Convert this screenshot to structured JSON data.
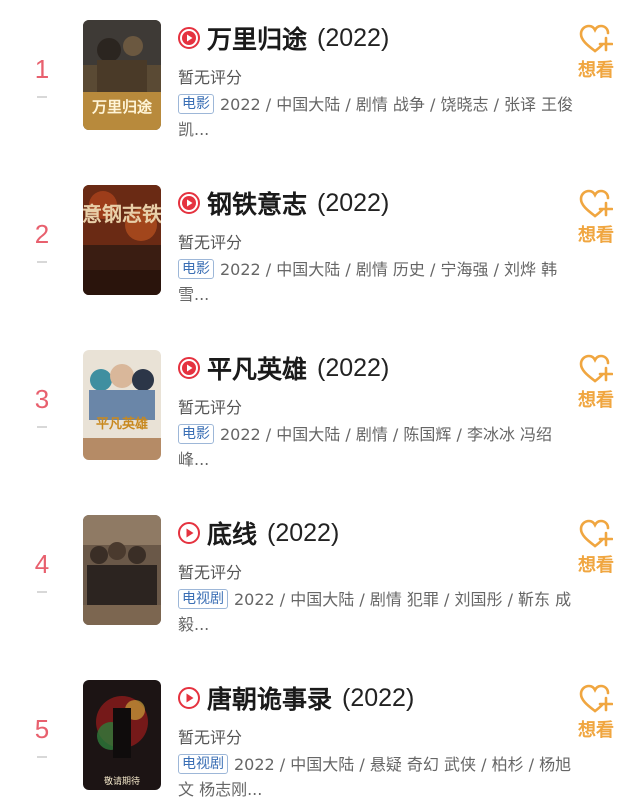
{
  "colors": {
    "rank": "#e8606e",
    "accent_orange": "#f0a640",
    "badge_blue": "#3b6fb5",
    "play_red": "#e5323f"
  },
  "items": [
    {
      "rank": "1",
      "play_icon": "movie-play-icon",
      "title": "万里归途",
      "year": "(2022)",
      "rating": "暂无评分",
      "badge": "电影",
      "meta": "2022 / 中国大陆 / 剧情 战争 / 饶晓志 / 张译 王俊凯...",
      "want_label": "想看",
      "poster_text": "万里归途"
    },
    {
      "rank": "2",
      "play_icon": "movie-play-icon",
      "title": "钢铁意志",
      "year": "(2022)",
      "rating": "暂无评分",
      "badge": "电影",
      "meta": "2022 / 中国大陆 / 剧情 历史 / 宁海强 / 刘烨 韩雪...",
      "want_label": "想看",
      "poster_text": "意钢志铁"
    },
    {
      "rank": "3",
      "play_icon": "movie-play-icon",
      "title": "平凡英雄",
      "year": "(2022)",
      "rating": "暂无评分",
      "badge": "电影",
      "meta": "2022 / 中国大陆 / 剧情 / 陈国辉 / 李冰冰 冯绍峰...",
      "want_label": "想看",
      "poster_text": "平凡英雄"
    },
    {
      "rank": "4",
      "play_icon": "tv-play-icon",
      "title": "底线",
      "year": "(2022)",
      "rating": "暂无评分",
      "badge": "电视剧",
      "meta": "2022 / 中国大陆 / 剧情 犯罪 / 刘国彤 / 靳东 成毅...",
      "want_label": "想看",
      "poster_text": ""
    },
    {
      "rank": "5",
      "play_icon": "tv-play-icon",
      "title": "唐朝诡事录",
      "year": "(2022)",
      "rating": "暂无评分",
      "badge": "电视剧",
      "meta": "2022 / 中国大陆 / 悬疑 奇幻 武侠 / 柏杉 / 杨旭文 杨志刚...",
      "want_label": "想看",
      "poster_text": "敬请期待"
    }
  ]
}
